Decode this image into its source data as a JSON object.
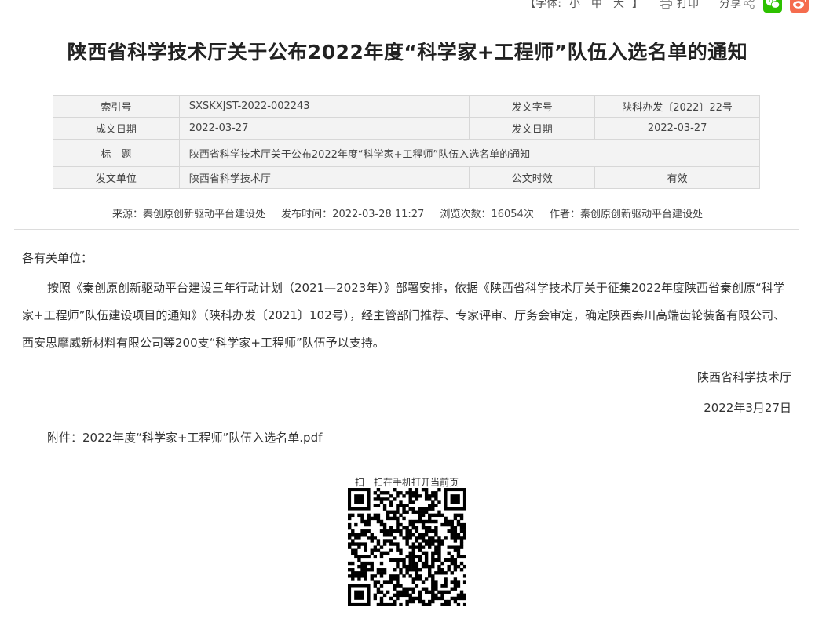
{
  "toolbar": {
    "font_label_open": "【字体:",
    "font_small": "小",
    "font_medium": "中",
    "font_large": "大",
    "font_label_close": "】",
    "print_label": "打印",
    "share_label": "分享",
    "wechat_color": "#2dc100",
    "weibo_color": "#f56c4e"
  },
  "page": {
    "title": "陕西省科学技术厅关于公布2022年度“科学家+工程师”队伍入选名单的通知"
  },
  "meta": {
    "index_no_label": "索引号",
    "index_no": "SXSKXJST-2022-002243",
    "doc_no_label": "发文字号",
    "doc_no": "陕科办发〔2022〕22号",
    "created_label": "成文日期",
    "created": "2022-03-27",
    "issued_label": "发文日期",
    "issued": "2022-03-27",
    "title_label": "标　题",
    "title": "陕西省科学技术厅关于公布2022年度“科学家+工程师”队伍入选名单的通知",
    "issuer_label": "发文单位",
    "issuer": "陕西省科学技术厅",
    "validity_label": "公文时效",
    "validity": "有效"
  },
  "info": {
    "source": "来源：秦创原创新驱动平台建设处",
    "publish_time": "发布时间：2022-03-28 11:27",
    "views": "浏览次数：16054次",
    "author": "作者：秦创原创新驱动平台建设处"
  },
  "content": {
    "salutation": "各有关单位：",
    "paragraph": "按照《秦创原创新驱动平台建设三年行动计划（2021—2023年）》部署安排，依据《陕西省科学技术厅关于征集2022年度陕西省秦创原“科学家+工程师”队伍建设项目的通知》（陕科办发〔2021〕102号），经主管部门推荐、专家评审、厅务会审定，确定陕西秦川高端齿轮装备有限公司、西安思摩威新材料有限公司等200支“科学家+工程师”队伍予以支持。",
    "signature": "陕西省科学技术厅",
    "date": "2022年3月27日",
    "attachment": "附件：2022年度“科学家+工程师”队伍入选名单.pdf"
  },
  "qr": {
    "caption": "扫一扫在手机打开当前页"
  }
}
